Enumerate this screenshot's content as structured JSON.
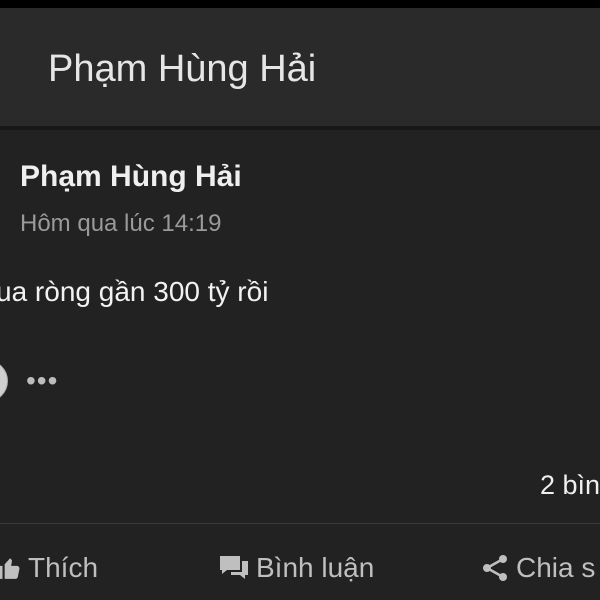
{
  "appbar": {
    "title": "Phạm Hùng Hải"
  },
  "post": {
    "author": "Phạm Hùng Hải",
    "timestamp": "Hôm qua lúc 14:19",
    "text": "ua ròng gần 300 tỷ rồi",
    "more_icon": "more-horizontal-icon",
    "comment_count": "2 bìn"
  },
  "actions": [
    {
      "label": "Thích",
      "icon": "thumbs-up-icon"
    },
    {
      "label": "Bình luận",
      "icon": "comment-icon"
    },
    {
      "label": "Chia s",
      "icon": "share-icon"
    }
  ],
  "colors": {
    "background": "#222222",
    "appbar": "#2a2a2a",
    "text_primary": "#efefef",
    "text_secondary": "#9a9a9a",
    "action_text": "#bfbfbf"
  }
}
